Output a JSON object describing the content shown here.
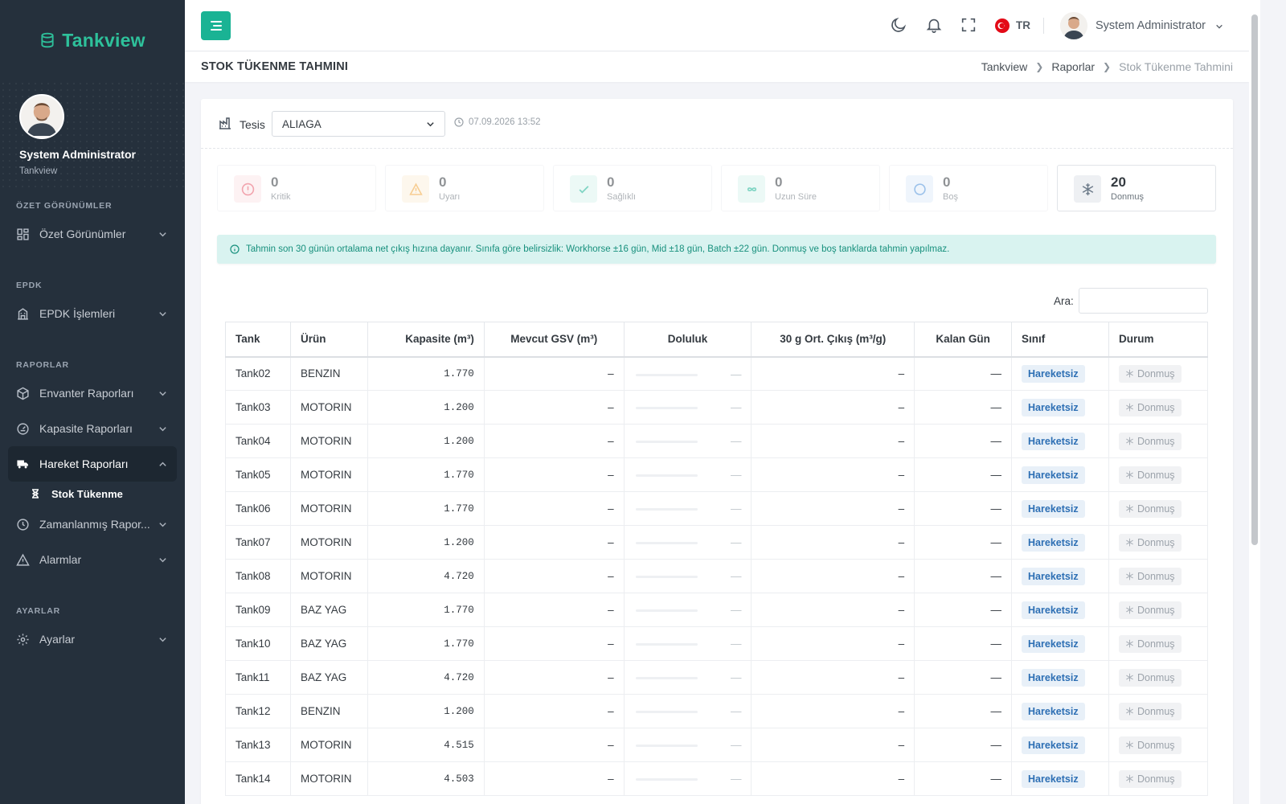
{
  "app": {
    "name": "Tankview"
  },
  "profile": {
    "name": "System Administrator",
    "org": "Tankview"
  },
  "nav": {
    "sections": {
      "overview": "ÖZET GÖRÜNÜMLER",
      "epdk": "EPDK",
      "reports": "RAPORLAR",
      "settings": "AYARLAR"
    },
    "items": {
      "overview": "Özet Görünümler",
      "epdk": "EPDK İşlemleri",
      "inventory": "Envanter Raporları",
      "capacity": "Kapasite Raporları",
      "movement": "Hareket Raporları",
      "stock_depletion": "Stok Tükenme",
      "scheduled": "Zamanlanmış Rapor...",
      "alarms": "Alarmlar",
      "settings": "Ayarlar"
    }
  },
  "topbar": {
    "lang": "TR",
    "user": "System Administrator"
  },
  "page": {
    "title": "STOK TÜKENME TAHMINI",
    "breadcrumb": [
      "Tankview",
      "Raporlar",
      "Stok Tükenme Tahmini"
    ]
  },
  "filter": {
    "label": "Tesis",
    "value": "ALIAGA",
    "datetime": "07.09.2026 13:52"
  },
  "stats": [
    {
      "label": "Kritik",
      "value": "0",
      "icon": "alert-circle-icon",
      "color": "#e85b6c"
    },
    {
      "label": "Uyarı",
      "value": "0",
      "icon": "warning-triangle-icon",
      "color": "#f2a63a"
    },
    {
      "label": "Sağlıklı",
      "value": "0",
      "icon": "check-icon",
      "color": "#1ab394"
    },
    {
      "label": "Uzun Süre",
      "value": "0",
      "icon": "infinity-icon",
      "color": "#1ab394"
    },
    {
      "label": "Boş",
      "value": "0",
      "icon": "circle-icon",
      "color": "#4a90d9"
    },
    {
      "label": "Donmuş",
      "value": "20",
      "icon": "snowflake-icon",
      "color": "#6c7a89"
    }
  ],
  "alert": {
    "text": "Tahmin son 30 günün ortalama net çıkış hızına dayanır. Sınıfa göre belirsizlik: Workhorse ±16 gün, Mid ±18 gün, Batch ±22 gün. Donmuş ve boş tanklarda tahmin yapılmaz."
  },
  "search": {
    "label": "Ara:",
    "value": ""
  },
  "table": {
    "headers": [
      "Tank",
      "Ürün",
      "Kapasite (m³)",
      "Mevcut GSV (m³)",
      "Doluluk",
      "30 g Ort. Çıkış (m³/g)",
      "Kalan Gün",
      "Sınıf",
      "Durum"
    ],
    "rows": [
      {
        "tank": "Tank02",
        "urun": "BENZIN",
        "kapasite": "1.770",
        "gsv": "–",
        "doluluk": "—",
        "cikis": "–",
        "kalan": "—",
        "sinif": "Hareketsiz",
        "durum": "Donmuş",
        "fill": 0
      },
      {
        "tank": "Tank03",
        "urun": "MOTORIN",
        "kapasite": "1.200",
        "gsv": "–",
        "doluluk": "—",
        "cikis": "–",
        "kalan": "—",
        "sinif": "Hareketsiz",
        "durum": "Donmuş",
        "fill": 0
      },
      {
        "tank": "Tank04",
        "urun": "MOTORIN",
        "kapasite": "1.200",
        "gsv": "–",
        "doluluk": "—",
        "cikis": "–",
        "kalan": "—",
        "sinif": "Hareketsiz",
        "durum": "Donmuş",
        "fill": 0
      },
      {
        "tank": "Tank05",
        "urun": "MOTORIN",
        "kapasite": "1.770",
        "gsv": "–",
        "doluluk": "—",
        "cikis": "–",
        "kalan": "—",
        "sinif": "Hareketsiz",
        "durum": "Donmuş",
        "fill": 0
      },
      {
        "tank": "Tank06",
        "urun": "MOTORIN",
        "kapasite": "1.770",
        "gsv": "–",
        "doluluk": "—",
        "cikis": "–",
        "kalan": "—",
        "sinif": "Hareketsiz",
        "durum": "Donmuş",
        "fill": 0
      },
      {
        "tank": "Tank07",
        "urun": "MOTORIN",
        "kapasite": "1.200",
        "gsv": "–",
        "doluluk": "—",
        "cikis": "–",
        "kalan": "—",
        "sinif": "Hareketsiz",
        "durum": "Donmuş",
        "fill": 0
      },
      {
        "tank": "Tank08",
        "urun": "MOTORIN",
        "kapasite": "4.720",
        "gsv": "–",
        "doluluk": "—",
        "cikis": "–",
        "kalan": "—",
        "sinif": "Hareketsiz",
        "durum": "Donmuş",
        "fill": 0
      },
      {
        "tank": "Tank09",
        "urun": "BAZ YAG",
        "kapasite": "1.770",
        "gsv": "–",
        "doluluk": "—",
        "cikis": "–",
        "kalan": "—",
        "sinif": "Hareketsiz",
        "durum": "Donmuş",
        "fill": 0
      },
      {
        "tank": "Tank10",
        "urun": "BAZ YAG",
        "kapasite": "1.770",
        "gsv": "–",
        "doluluk": "—",
        "cikis": "–",
        "kalan": "—",
        "sinif": "Hareketsiz",
        "durum": "Donmuş",
        "fill": 0
      },
      {
        "tank": "Tank11",
        "urun": "BAZ YAG",
        "kapasite": "4.720",
        "gsv": "–",
        "doluluk": "—",
        "cikis": "–",
        "kalan": "—",
        "sinif": "Hareketsiz",
        "durum": "Donmuş",
        "fill": 0
      },
      {
        "tank": "Tank12",
        "urun": "BENZIN",
        "kapasite": "1.200",
        "gsv": "–",
        "doluluk": "—",
        "cikis": "–",
        "kalan": "—",
        "sinif": "Hareketsiz",
        "durum": "Donmuş",
        "fill": 0
      },
      {
        "tank": "Tank13",
        "urun": "MOTORIN",
        "kapasite": "4.515",
        "gsv": "–",
        "doluluk": "—",
        "cikis": "–",
        "kalan": "—",
        "sinif": "Hareketsiz",
        "durum": "Donmuş",
        "fill": 0
      },
      {
        "tank": "Tank14",
        "urun": "MOTORIN",
        "kapasite": "4.503",
        "gsv": "–",
        "doluluk": "—",
        "cikis": "–",
        "kalan": "—",
        "sinif": "Hareketsiz",
        "durum": "Donmuş",
        "fill": 0
      }
    ]
  }
}
